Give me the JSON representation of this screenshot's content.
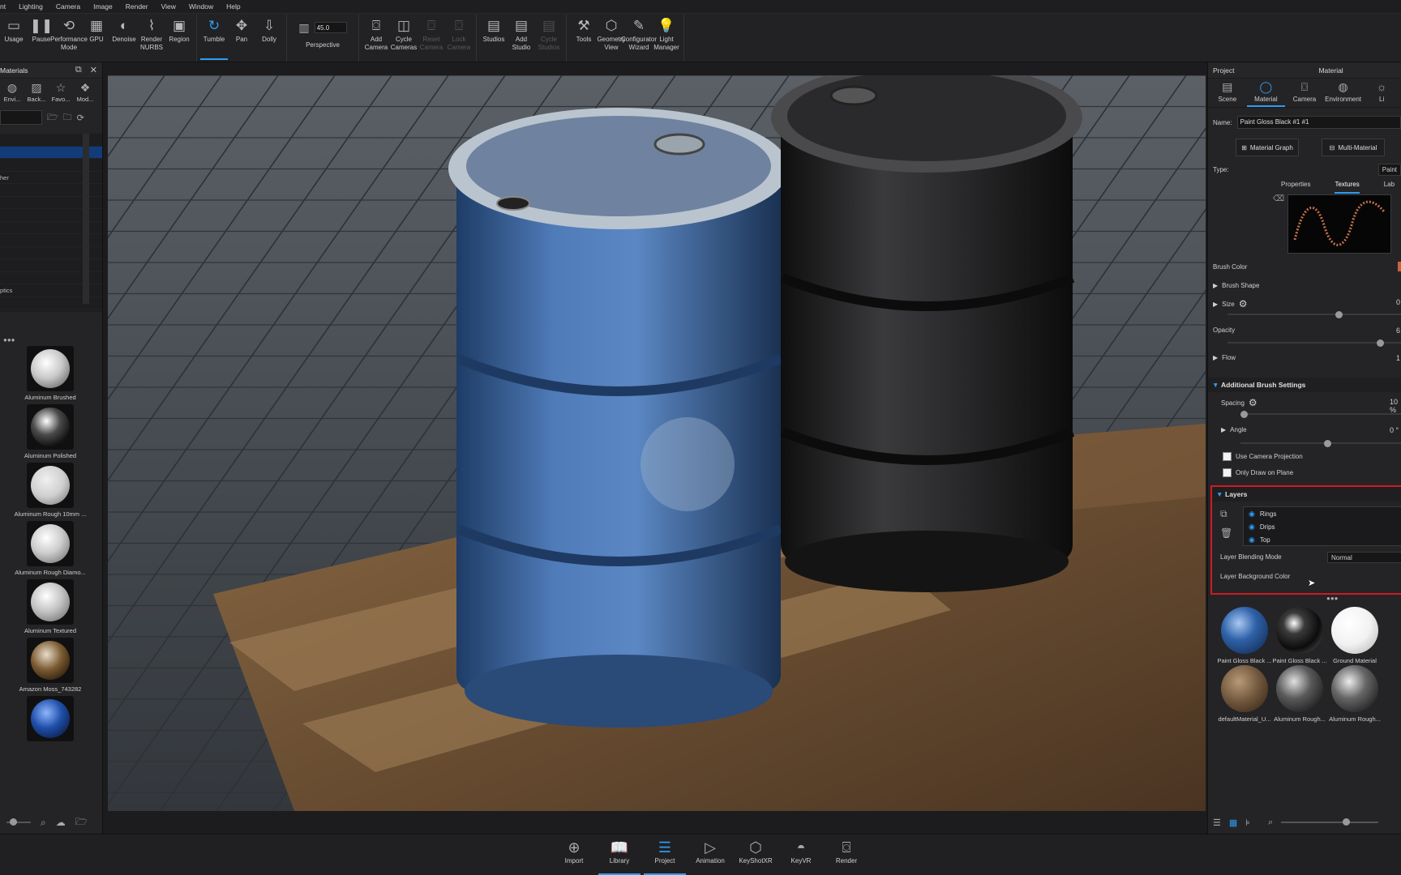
{
  "menu": [
    "nt",
    "Lighting",
    "Camera",
    "Image",
    "Render",
    "View",
    "Window",
    "Help"
  ],
  "toolbar": {
    "items": [
      {
        "label": "Usage",
        "icon": "usage-icon",
        "glyph": "▭"
      },
      {
        "label": "Pause",
        "icon": "pause-icon",
        "glyph": "❚❚"
      },
      {
        "label": "Performance Mode",
        "icon": "performance-icon",
        "glyph": "⟲"
      },
      {
        "label": "GPU",
        "icon": "gpu-icon",
        "glyph": "▦"
      },
      {
        "label": "Denoise",
        "icon": "denoise-icon",
        "glyph": "◐"
      },
      {
        "label": "Render NURBS",
        "icon": "nurbs-icon",
        "glyph": "⌇"
      },
      {
        "label": "Region",
        "icon": "region-icon",
        "glyph": "▣"
      },
      {
        "label": "Tumble",
        "icon": "tumble-icon",
        "glyph": "↻",
        "selected": true
      },
      {
        "label": "Pan",
        "icon": "pan-icon",
        "glyph": "✥"
      },
      {
        "label": "Dolly",
        "icon": "dolly-icon",
        "glyph": "⇩"
      },
      {
        "label": "Perspective",
        "icon": "perspective-icon",
        "glyph": "▥",
        "fov": "45.0"
      },
      {
        "label": "Add Camera",
        "icon": "add-camera-icon",
        "glyph": "⌼"
      },
      {
        "label": "Cycle Cameras",
        "icon": "cycle-cameras-icon",
        "glyph": "◫"
      },
      {
        "label": "Reset Camera",
        "icon": "reset-camera-icon",
        "glyph": "⌼",
        "dim": true
      },
      {
        "label": "Lock Camera",
        "icon": "lock-camera-icon",
        "glyph": "⌼",
        "dim": true
      },
      {
        "label": "Studios",
        "icon": "studios-icon",
        "glyph": "▤"
      },
      {
        "label": "Add Studio",
        "icon": "add-studio-icon",
        "glyph": "▤"
      },
      {
        "label": "Cycle Studios",
        "icon": "cycle-studios-icon",
        "glyph": "▤",
        "dim": true
      },
      {
        "label": "Tools",
        "icon": "tools-icon",
        "glyph": "⚒"
      },
      {
        "label": "Geometry View",
        "icon": "geometry-view-icon",
        "glyph": "⬡"
      },
      {
        "label": "Configurator Wizard",
        "icon": "configurator-icon",
        "glyph": "✎"
      },
      {
        "label": "Light Manager",
        "icon": "light-manager-icon",
        "glyph": "💡"
      }
    ]
  },
  "left": {
    "title": "Materials",
    "tabs": [
      {
        "label": "Envi...",
        "icon": "environment-icon",
        "glyph": "◍"
      },
      {
        "label": "Back...",
        "icon": "backplate-icon",
        "glyph": "▨"
      },
      {
        "label": "Favo...",
        "icon": "favorites-icon",
        "glyph": "☆"
      },
      {
        "label": "Mod...",
        "icon": "models-icon",
        "glyph": "❖"
      }
    ],
    "tree": [
      "",
      "",
      "",
      "her",
      "",
      "",
      "",
      "",
      "",
      "",
      "",
      "",
      "ptics",
      "",
      ""
    ],
    "thumbs": [
      {
        "label": "Aluminum Brushed",
        "color": "radial-gradient(circle at 40% 35%,#ffffff,#c9c9c9 45%,#7a7a7a 80%)"
      },
      {
        "label": "Aluminum Polished",
        "color": "radial-gradient(circle at 40% 35%,#ffffff,#4a4a4a 40%,#111 75%,#888 95%)"
      },
      {
        "label": "Aluminum Rough 10mm ...",
        "color": "radial-gradient(circle at 40% 35%,#f0f0f0,#cfcfcf 50%,#8a8a8a 85%)"
      },
      {
        "label": "Aluminum Rough Diamo...",
        "color": "radial-gradient(circle at 40% 35%,#ffffff,#cdcdcd 45%,#7e7e7e 85%)"
      },
      {
        "label": "Aluminum Textured",
        "color": "radial-gradient(circle at 40% 35%,#ffffff,#c4c4c4 45%,#7a7a7a 85%)"
      },
      {
        "label": "Amazon Moss_743282",
        "color": "radial-gradient(circle at 40% 35%,#e8dcc8,#7a5a32 45%,#2a1c0c 85%)"
      },
      {
        "label": "",
        "color": "radial-gradient(circle at 40% 35%,#8fb4ff,#1f4ea8 45%,#0c1f4a 85%)"
      }
    ]
  },
  "right": {
    "header": {
      "project": "Project",
      "material": "Material"
    },
    "tabs": [
      {
        "label": "Scene",
        "icon": "scene-icon",
        "glyph": "▤"
      },
      {
        "label": "Material",
        "icon": "material-icon",
        "glyph": "◯",
        "selected": true
      },
      {
        "label": "Camera",
        "icon": "camera-icon",
        "glyph": "⌼"
      },
      {
        "label": "Environment",
        "icon": "environment-globe-icon",
        "glyph": "◍"
      },
      {
        "label": "Li",
        "icon": "lights-icon",
        "glyph": "☼"
      }
    ],
    "name_label": "Name:",
    "name_value": "Paint Gloss Black #1 #1",
    "material_graph": "Material Graph",
    "multi_material": "Multi-Material",
    "type_label": "Type:",
    "type_value": "Paint",
    "subtabs": [
      "Properties",
      "Textures",
      "Lab"
    ],
    "brush_color": "Brush Color",
    "brush_shape": "Brush Shape",
    "size": "Size",
    "size_value": "0",
    "opacity": "Opacity",
    "opacity_value": "6",
    "flow": "Flow",
    "flow_value": "1",
    "additional": "Additional Brush Settings",
    "spacing": "Spacing",
    "spacing_value": "10 %",
    "angle": "Angle",
    "angle_value": "0 °",
    "use_camera": "Use Camera Projection",
    "only_plane": "Only Draw on Plane",
    "layers_title": "Layers",
    "layers": [
      "Rings",
      "Drips",
      "Top"
    ],
    "blend_label": "Layer Blending Mode",
    "blend_value": "Normal",
    "bg_label": "Layer Background Color",
    "materials": [
      {
        "label": "Paint Gloss Black ...",
        "color": "radial-gradient(circle at 38% 35%,#a9c8f2,#2f62a8 40%,#183766 80%)"
      },
      {
        "label": "Paint Gloss Black ...",
        "color": "radial-gradient(circle at 38% 35%,#ffffff 0,#3a3a3a 25%,#0c0c0c 60%,#5a5a5a 95%)"
      },
      {
        "label": "Ground Material",
        "color": "radial-gradient(circle at 38% 35%,#ffffff,#f2f2f2 50%,#bcbcbc 90%)"
      },
      {
        "label": "defaultMaterial_U...",
        "color": "radial-gradient(circle at 38% 35%,#b89a78,#6e543a 50%,#3a2a1a 90%)"
      },
      {
        "label": "Aluminum Rough...",
        "color": "radial-gradient(circle at 38% 35%,#e0e0e0,#5a5a5a 40%,#1a1a1a 85%)"
      },
      {
        "label": "Aluminum Rough...",
        "color": "radial-gradient(circle at 38% 35%,#ececec,#666 40%,#1e1e1e 85%)"
      }
    ]
  },
  "bottom": [
    {
      "label": "Import",
      "icon": "import-icon",
      "glyph": "⊕"
    },
    {
      "label": "Library",
      "icon": "library-icon",
      "glyph": "📖",
      "selected": true
    },
    {
      "label": "Project",
      "icon": "project-icon",
      "glyph": "☰",
      "selected": true
    },
    {
      "label": "Animation",
      "icon": "animation-icon",
      "glyph": "▷"
    },
    {
      "label": "KeyShotXR",
      "icon": "keyshotxr-icon",
      "glyph": "⬡"
    },
    {
      "label": "KeyVR",
      "icon": "keyvr-icon",
      "glyph": "◓"
    },
    {
      "label": "Render",
      "icon": "render-icon",
      "glyph": "⌼"
    }
  ]
}
